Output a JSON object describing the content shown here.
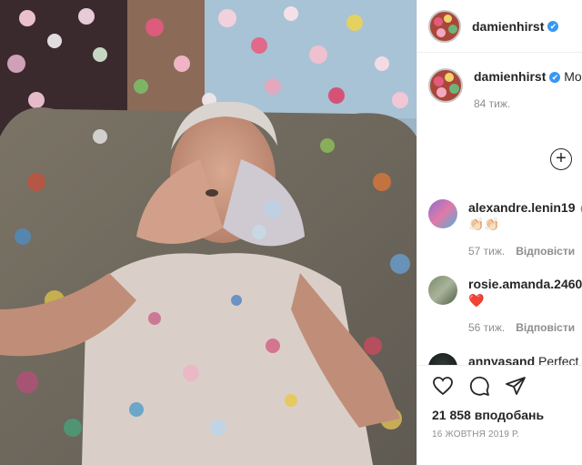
{
  "post": {
    "author": "damienhirst",
    "verified_mark": "✔",
    "caption_text": "More paint on my chair than on my pa",
    "caption_age": "84 тиж.",
    "load_more_symbol": "+",
    "likes": "21 858 вподобань",
    "date": "16 ЖОВТНЯ 2019 Р.",
    "reply_label": "Відповісти"
  },
  "comments": [
    {
      "user": "alexandre.lenin19",
      "text": "🔥",
      "text2": "👏🏻👏🏻",
      "age": "57 тиж."
    },
    {
      "user": "rosie.amanda.2460",
      "text": "",
      "text2": "❤️",
      "age": "56 тиж."
    },
    {
      "user": "annyasand",
      "text": "Perfect",
      "text2": "",
      "age": ""
    }
  ],
  "icons": [
    "heart-icon",
    "comment-icon",
    "share-icon",
    "add-icon"
  ],
  "colors": {
    "verified": "#3897f0",
    "secondary_text": "#8e8e8e",
    "heart": "#ed4956"
  }
}
